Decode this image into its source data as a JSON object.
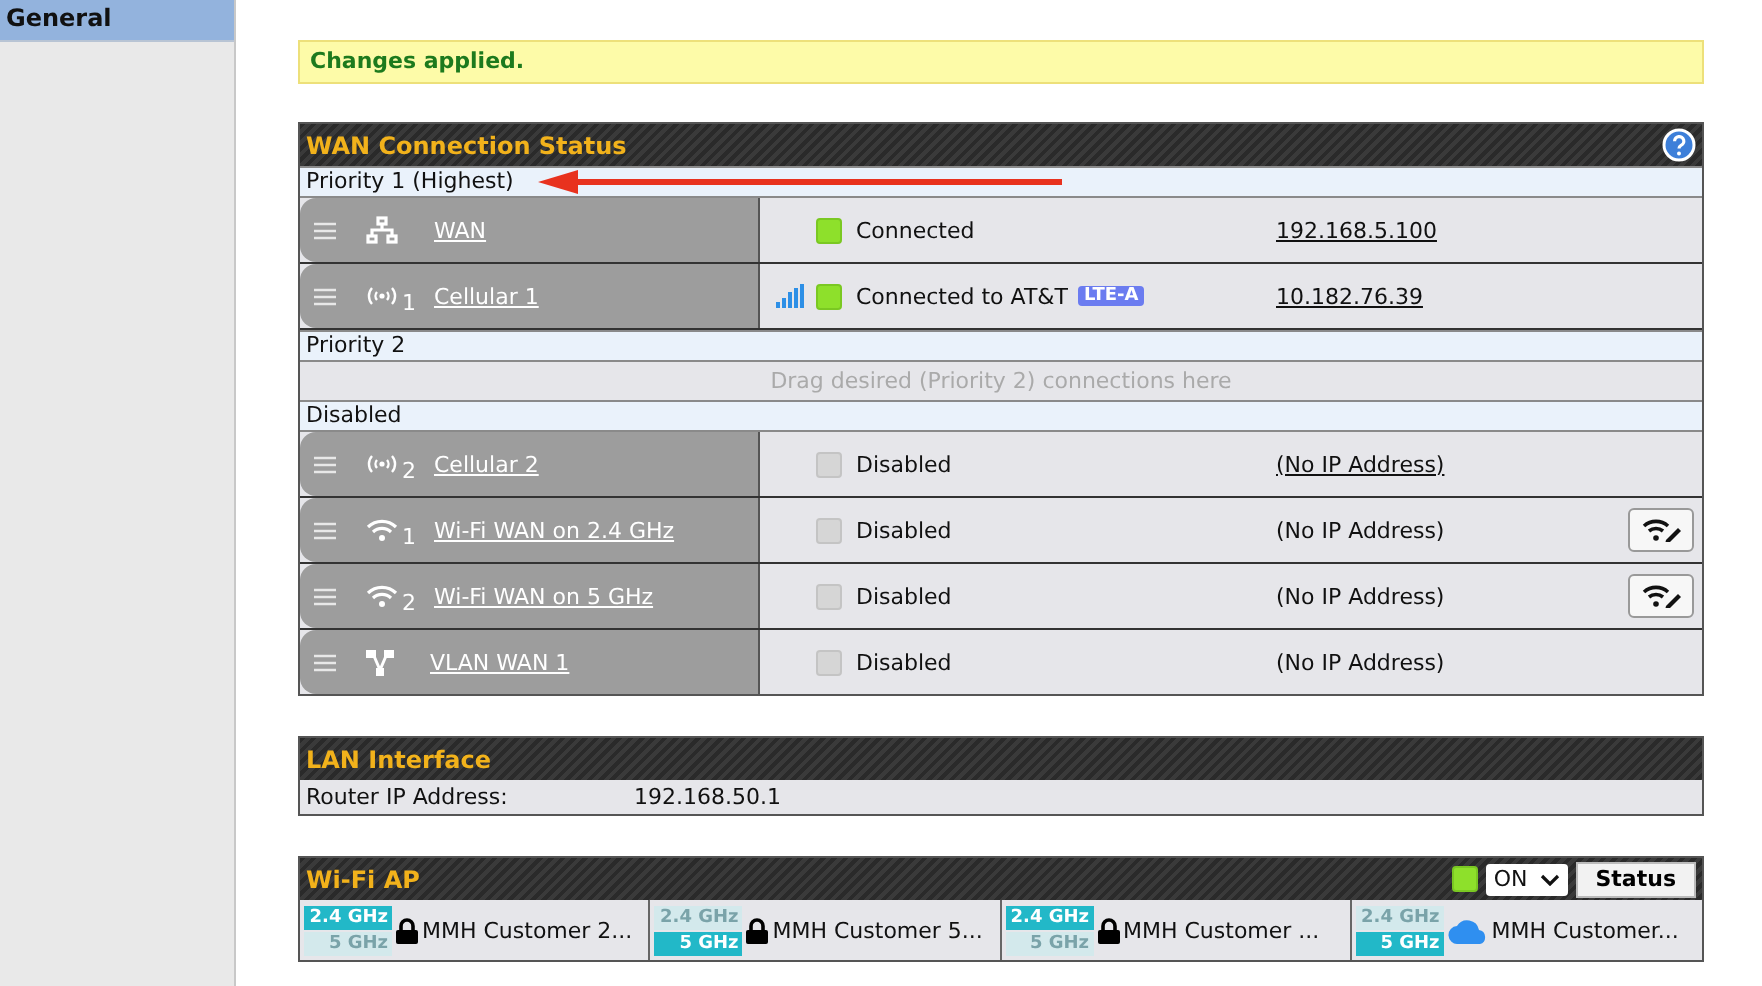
{
  "sidebar": {
    "items": [
      {
        "label": "General",
        "selected": true
      }
    ]
  },
  "notice": "Changes applied.",
  "wan": {
    "title": "WAN Connection Status",
    "groups": [
      {
        "label": "Priority 1 (Highest)",
        "connections": [
          {
            "kind": "ethernet",
            "name": "WAN",
            "signal": false,
            "connected": true,
            "status": "Connected",
            "ip": "192.168.5.100",
            "ip_link": true,
            "wifi_button": false
          },
          {
            "kind": "cellular",
            "number": "1",
            "name": "Cellular 1",
            "signal": true,
            "connected": true,
            "status": "Connected to AT&T",
            "badge": "LTE-A",
            "ip": "10.182.76.39",
            "ip_link": true,
            "wifi_button": false
          }
        ]
      },
      {
        "label": "Priority 2",
        "placeholder": "Drag desired (Priority 2) connections here"
      },
      {
        "label": "Disabled",
        "connections": [
          {
            "kind": "cellular",
            "number": "2",
            "name": "Cellular 2",
            "signal": false,
            "connected": false,
            "status": "Disabled",
            "ip": "(No IP Address)",
            "ip_link": true,
            "wifi_button": false
          },
          {
            "kind": "wifi",
            "number": "1",
            "name": "Wi-Fi WAN on 2.4 GHz",
            "signal": false,
            "connected": false,
            "status": "Disabled",
            "ip": "(No IP Address)",
            "ip_link": false,
            "wifi_button": true
          },
          {
            "kind": "wifi",
            "number": "2",
            "name": "Wi-Fi WAN on 5 GHz",
            "signal": false,
            "connected": false,
            "status": "Disabled",
            "ip": "(No IP Address)",
            "ip_link": false,
            "wifi_button": true
          },
          {
            "kind": "vlan",
            "name": "VLAN WAN 1",
            "signal": false,
            "connected": false,
            "status": "Disabled",
            "ip": "(No IP Address)",
            "ip_link": false,
            "wifi_button": false
          }
        ]
      }
    ]
  },
  "lan": {
    "title": "LAN Interface",
    "label": "Router IP Address:",
    "value": "192.168.50.1"
  },
  "wifi_ap": {
    "title": "Wi-Fi AP",
    "on": true,
    "select_value": "ON",
    "status_button": "Status",
    "ssids": [
      {
        "kind": "lock",
        "band_24": "2.4 GHz",
        "band_24_on": true,
        "band_5": "5 GHz",
        "band_5_on": false,
        "name": "MMH Customer 2..."
      },
      {
        "kind": "lock",
        "band_24": "2.4 GHz",
        "band_24_on": false,
        "band_5": "5 GHz",
        "band_5_on": true,
        "name": "MMH Customer 5..."
      },
      {
        "kind": "lock",
        "band_24": "2.4 GHz",
        "band_24_on": true,
        "band_5": "5 GHz",
        "band_5_on": false,
        "name": "MMH Customer ..."
      },
      {
        "kind": "cloud",
        "band_24": "2.4 GHz",
        "band_24_on": false,
        "band_5": "5 GHz",
        "band_5_on": true,
        "name": "MMH Customer..."
      }
    ]
  }
}
